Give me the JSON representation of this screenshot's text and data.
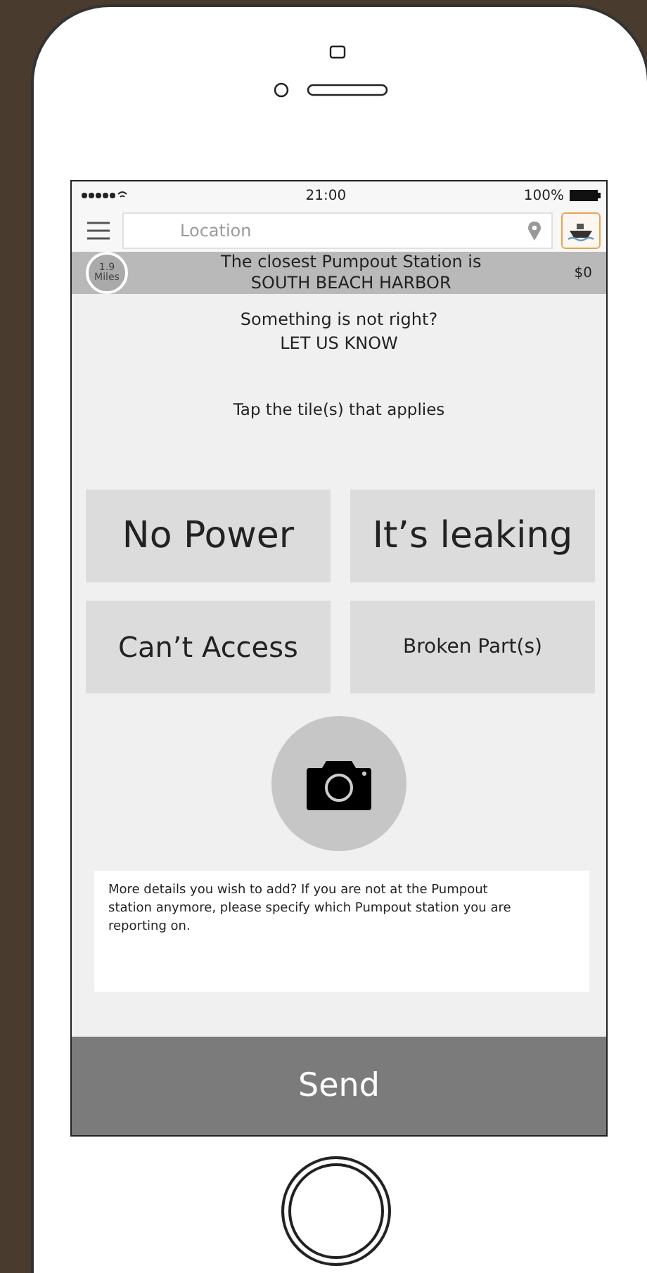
{
  "status_bar": {
    "time": "21:00",
    "battery": "100%"
  },
  "nav": {
    "search": {
      "placeholder": "Location"
    }
  },
  "banner": {
    "distance": "1.9",
    "unit": "Miles",
    "line_1": "The closest Pumpout Station is",
    "line_2": "SOUTH BEACH HARBOR",
    "price": "$0"
  },
  "report": {
    "question": "Something is not right?",
    "call": "LET US KNOW",
    "hint": "Tap the tile(s) that applies"
  },
  "tiles": [
    {
      "label": "No Power",
      "selected": false
    },
    {
      "label": "It’s leaking",
      "selected": false
    },
    {
      "label": "Can’t Access",
      "selected": false
    },
    {
      "label": "Broken Part(s)",
      "selected": false
    }
  ],
  "details": {
    "placeholder": "More details you wish to add? If you are not at the Pumpout station anymore, please specify which Pumpout station you are reporting on."
  },
  "send_button": "Send"
}
